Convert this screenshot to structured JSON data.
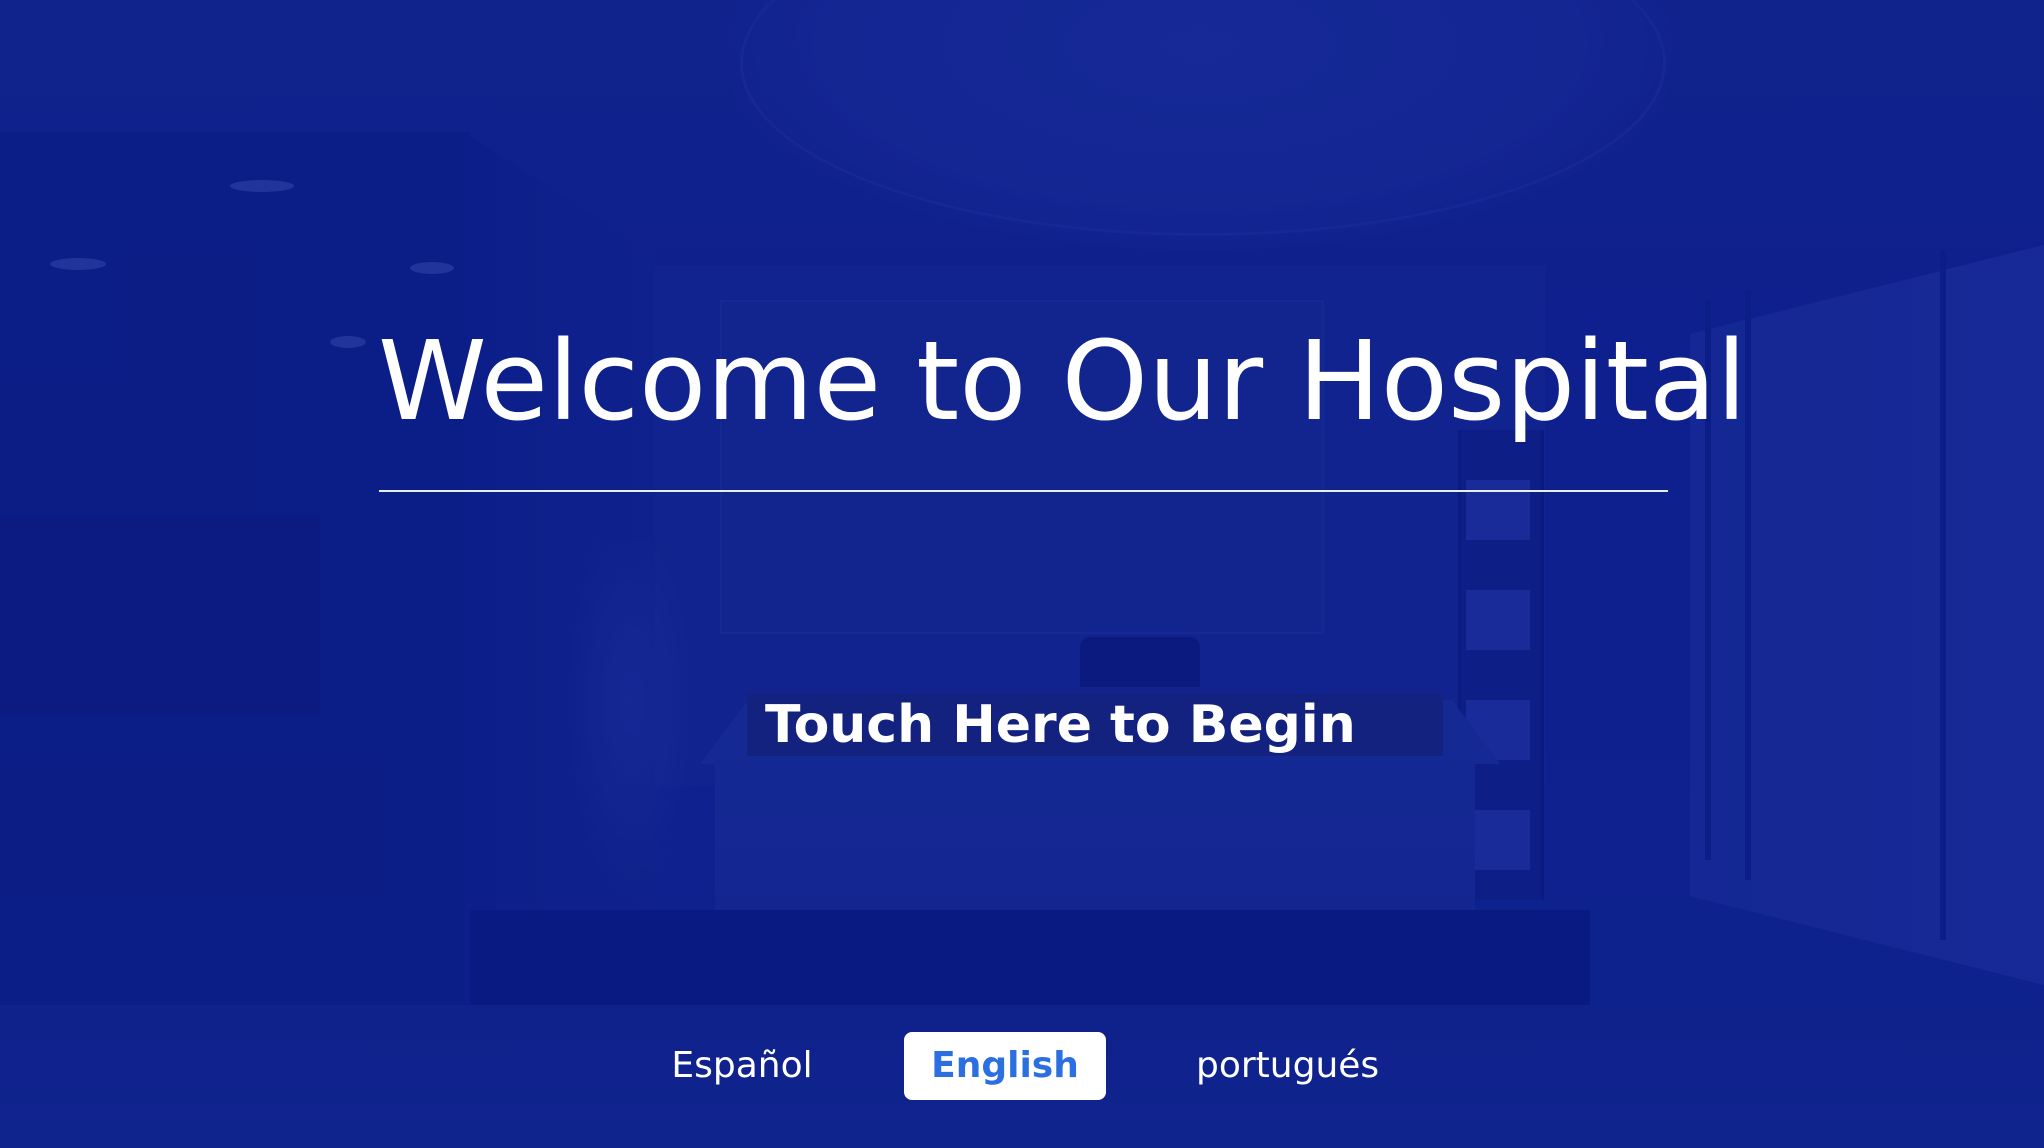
{
  "kiosk": {
    "title": "Welcome to Our Hospital",
    "begin_label": "Touch Here to Begin"
  },
  "languages": {
    "options": [
      {
        "label": "Español",
        "selected": false
      },
      {
        "label": "English",
        "selected": true
      },
      {
        "label": "portugués",
        "selected": false
      }
    ]
  },
  "colors": {
    "background_tint": "#10248a",
    "text": "#ffffff",
    "selected_language_bg": "#ffffff",
    "selected_language_text": "#2b6fe0",
    "begin_button_bg": "#12227e"
  }
}
